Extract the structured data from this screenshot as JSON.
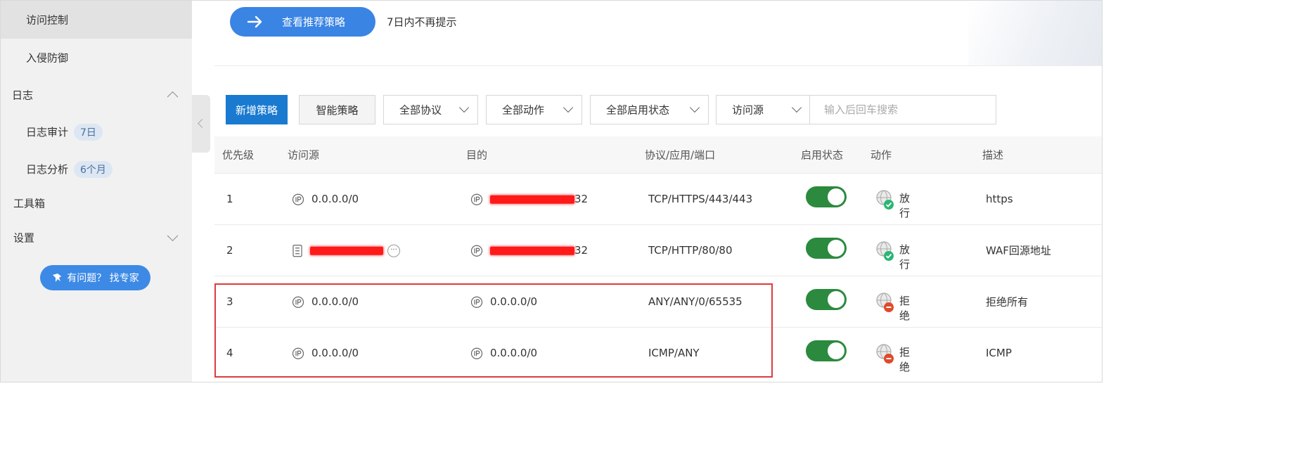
{
  "sidebar": {
    "items": [
      {
        "label": "访问控制",
        "active": true
      },
      {
        "label": "入侵防御"
      },
      {
        "label": "日志",
        "expanded": true
      },
      {
        "label": "日志审计",
        "badge": "7日"
      },
      {
        "label": "日志分析",
        "badge": "6个月"
      },
      {
        "label": "工具箱"
      },
      {
        "label": "设置",
        "expanded": false
      }
    ],
    "expert_button": "有问题？ 找专家"
  },
  "banner": {
    "recommend_button": "查看推荐策略",
    "dismiss_text": "7日内不再提示"
  },
  "toolbar": {
    "add_button": "新增策略",
    "smart_button": "智能策略",
    "protocol_filter": "全部协议",
    "action_filter": "全部动作",
    "state_filter": "全部启用状态",
    "source_filter": "访问源",
    "search_placeholder": "输入后回车搜索"
  },
  "table": {
    "headers": [
      "优先级",
      "访问源",
      "目的",
      "协议/应用/端口",
      "启用状态",
      "动作",
      "描述"
    ],
    "rows": [
      {
        "priority": "1",
        "source": "0.0.0.0/0",
        "source_type": "ip",
        "dest": "32",
        "dest_redacted": true,
        "protocol": "TCP/HTTPS/443/443",
        "enabled": true,
        "action": "放行",
        "action_type": "allow",
        "desc": "https"
      },
      {
        "priority": "2",
        "source": "",
        "source_type": "addressbook",
        "source_redacted": true,
        "dest": "32",
        "dest_redacted": true,
        "protocol": "TCP/HTTP/80/80",
        "enabled": true,
        "action": "放行",
        "action_type": "allow",
        "desc": "WAF回源地址"
      },
      {
        "priority": "3",
        "source": "0.0.0.0/0",
        "source_type": "ip",
        "dest": "0.0.0.0/0",
        "protocol": "ANY/ANY/0/65535",
        "enabled": true,
        "action": "拒绝",
        "action_type": "deny",
        "desc": "拒绝所有"
      },
      {
        "priority": "4",
        "source": "0.0.0.0/0",
        "source_type": "ip",
        "dest": "0.0.0.0/0",
        "protocol": "ICMP/ANY",
        "enabled": true,
        "action": "拒绝",
        "action_type": "deny",
        "desc": "ICMP"
      }
    ]
  },
  "colors": {
    "primary": "#1a7ad0",
    "banner_button": "#3a84e4",
    "toggle_on": "#2b8a3e",
    "allow": "#2bb673",
    "deny": "#e04a2a",
    "highlight_box": "#e03b3b",
    "sidebar_bg": "#f1f1f1"
  }
}
